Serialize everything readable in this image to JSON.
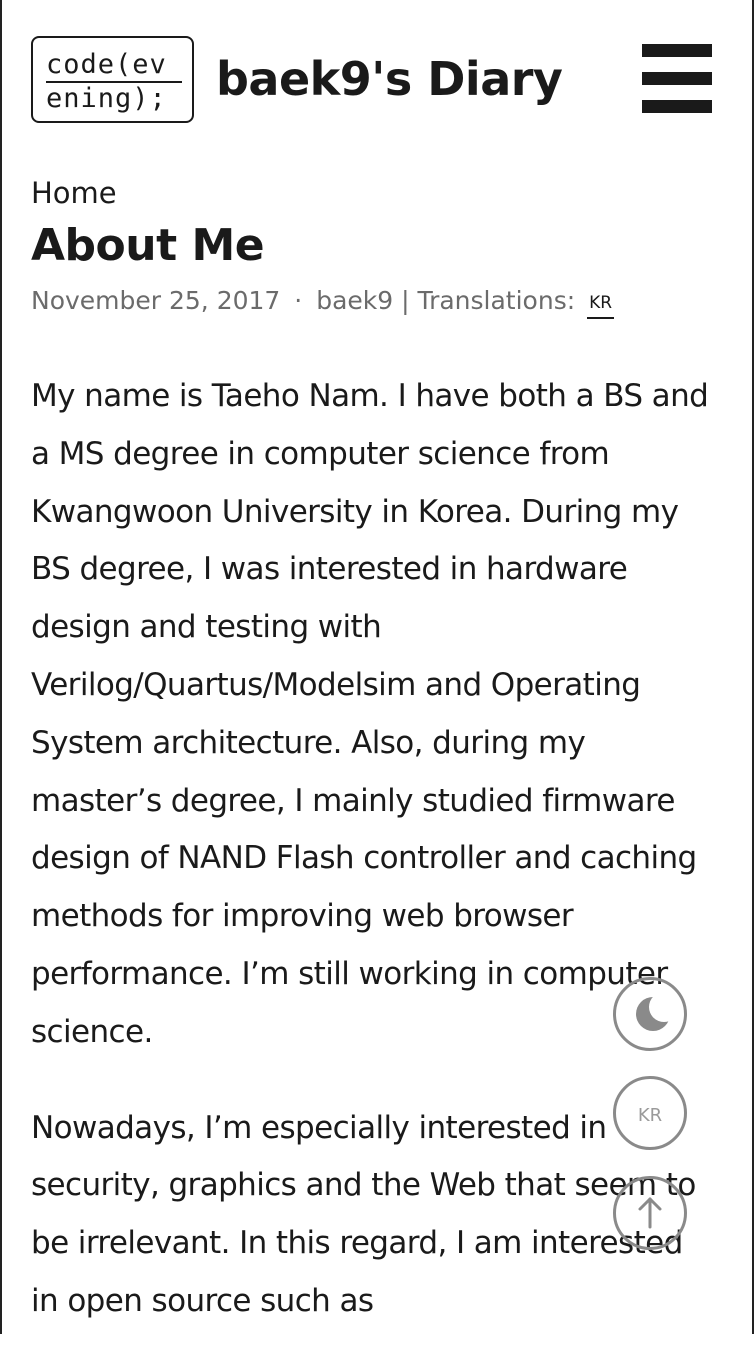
{
  "header": {
    "logo_line1": "code(ev",
    "logo_line2": "ening);",
    "site_title": "baek9's Diary",
    "menu_icon": "hamburger-menu-icon"
  },
  "breadcrumb": {
    "home": "Home"
  },
  "post": {
    "title": "About Me",
    "date": "November 25, 2017",
    "separator": "·",
    "author": "baek9",
    "translations_label": "| Translations:",
    "translation_lang": "KR",
    "paragraphs": [
      "My name is Taeho Nam. I have both a BS and a MS degree in computer science from Kwangwoon University in Korea. During my BS degree, I was interested in hardware design and testing with Verilog/Quartus/Modelsim and Operating System architecture. Also, during my master’s degree, I mainly studied firmware design of NAND Flash controller and caching methods for improving web browser performance. I’m still working in computer science.",
      "Nowadays, I’m especially interested in security, graphics and the Web that seem to be irrelevant. In this regard, I am interested in open source such as"
    ]
  },
  "floating_buttons": {
    "dark_mode_icon": "moon-icon",
    "language_label": "KR",
    "scroll_top_icon": "arrow-up-icon"
  },
  "colors": {
    "text": "#1a1a1a",
    "meta": "#6b6b6b",
    "fab_border": "#8a8a8a"
  }
}
